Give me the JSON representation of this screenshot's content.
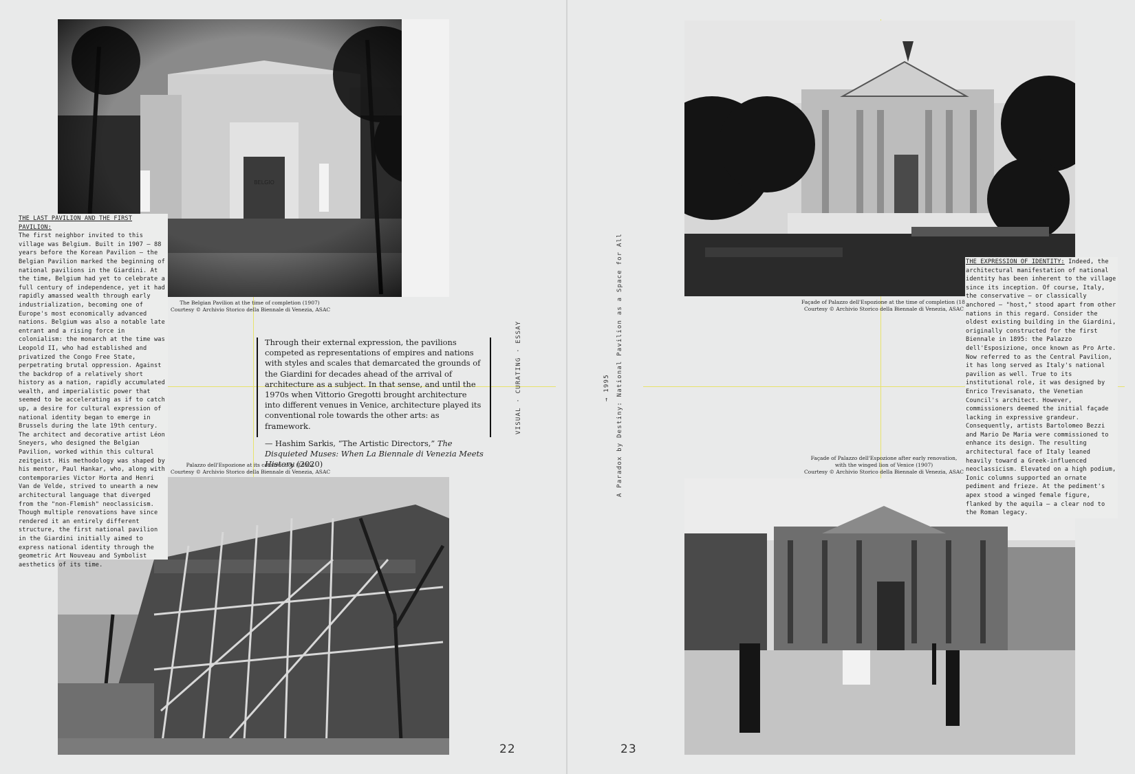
{
  "left_page": {
    "photo_top": {
      "caption_line1": "The Belgian Pavilion at the time of completion (1907)",
      "caption_line2": "Courtesy © Archivio Storico della Biennale di Venezia, ASAC",
      "sign_text": "BELGIO"
    },
    "photo_bottom": {
      "caption_line1": "Palazzo dell'Espozione at its construction (1895)",
      "caption_line2": "Courtesy © Archivio Storico della Biennale di Venezia, ASAC"
    },
    "essay": {
      "heading": "THE LAST PAVILION AND THE FIRST PAVILION:",
      "body": "The first neighbor invited to this village was Belgium. Built in 1907 — 88 years before the Korean Pavilion — the Belgian Pavilion marked the beginning of national pavilions in the Giardini. At the time, Belgium had yet to celebrate a full century of independence, yet it had rapidly amassed wealth through early industrialization, becoming one of Europe's most economically advanced nations. Belgium was also a notable late entrant and a rising force in colonialism: the monarch at the time was Leopold II, who had established and privatized the Congo Free State, perpetrating brutal oppression. Against the backdrop of a relatively short history as a nation, rapidly accumulated wealth, and imperialistic power that seemed to be accelerating as if to catch up, a desire for cultural expression of national identity began to emerge in Brussels during the late 19th century. The architect and decorative artist Léon Sneyers, who designed the Belgian Pavilion, worked within this cultural zeitgeist. His methodology was shaped by his mentor, Paul Hankar, who, along with contemporaries Victor Horta and Henri Van de Velde, strived to unearth a new architectural language that diverged from the \"non-Flemish\" neoclassicism. Though multiple renovations have since rendered it an entirely different structure, the first national pavilion in the Giardini initially aimed to express national identity through the geometric Art Nouveau and Symbolist aesthetics of its time."
    },
    "quote": {
      "text": "Through their external expression, the pavilions competed as representations of empires and nations with styles and scales that demarcated the grounds of the Giardini for decades ahead of the arrival of architecture as a subject. In that sense, and until the 1970s when Vittorio Gregotti brought architecture into different venues in Venice, architecture played its conventional role towards the other arts: as framework.",
      "attribution_prefix": "— Hashim Sarkis, “The Artistic Directors,” ",
      "attribution_title": "The Disquieted Muses: When La Biennale di Venezia Meets History",
      "attribution_year": " (2020)"
    },
    "section_label": "VISUAL · CURATING · ESSAY",
    "page_number": "22"
  },
  "right_page": {
    "photo_top": {
      "caption_line1": "Façade of Palazzo dell'Espozione at the time of completion (1895)",
      "caption_line2": "Courtesy © Archivio Storico della Biennale di Venezia, ASAC"
    },
    "photo_bottom": {
      "caption_line1": "Façade of Palazzo dell'Espozione after early renovation,",
      "caption_line2": "with the winged lion of Venice (1907)",
      "caption_line3": "Courtesy © Archivio Storico della Biennale di Venezia, ASAC"
    },
    "essay": {
      "heading": "THE EXPRESSION OF IDENTITY:",
      "body": "Indeed, the architectural manifestation of national identity has been inherent to the village since its inception. Of course, Italy, the conservative — or classically anchored — \"host,\" stood apart from other nations in this regard. Consider the oldest existing building in the Giardini, originally constructed for the first Biennale in 1895: the Palazzo dell'Esposizione, once known as Pro Arte. Now referred to as the Central Pavilion, it has long served as Italy's national pavilion as well. True to its institutional role, it was designed by Enrico Trevisanato, the Venetian Council's architect. However, commissioners deemed the initial façade lacking in expressive grandeur. Consequently, artists Bartolomeo Bezzi and Mario De Maria were commissioned to enhance its design. The resulting architectural face of Italy leaned heavily toward a Greek-influenced neoclassicism. Elevated on a high podium, Ionic columns supported an ornate pediment and frieze. At the pediment's apex stood a winged female figure, flanked by the aquila — a clear nod to the Roman legacy."
    },
    "running_title": "A Paradox by Destiny: National Pavilion as a Space for All",
    "year_marker": "→ 1995",
    "page_number": "23"
  },
  "colors": {
    "paper": "#e9eaea",
    "guide_line": "#e8e36a",
    "ink": "#1a1a1a"
  }
}
